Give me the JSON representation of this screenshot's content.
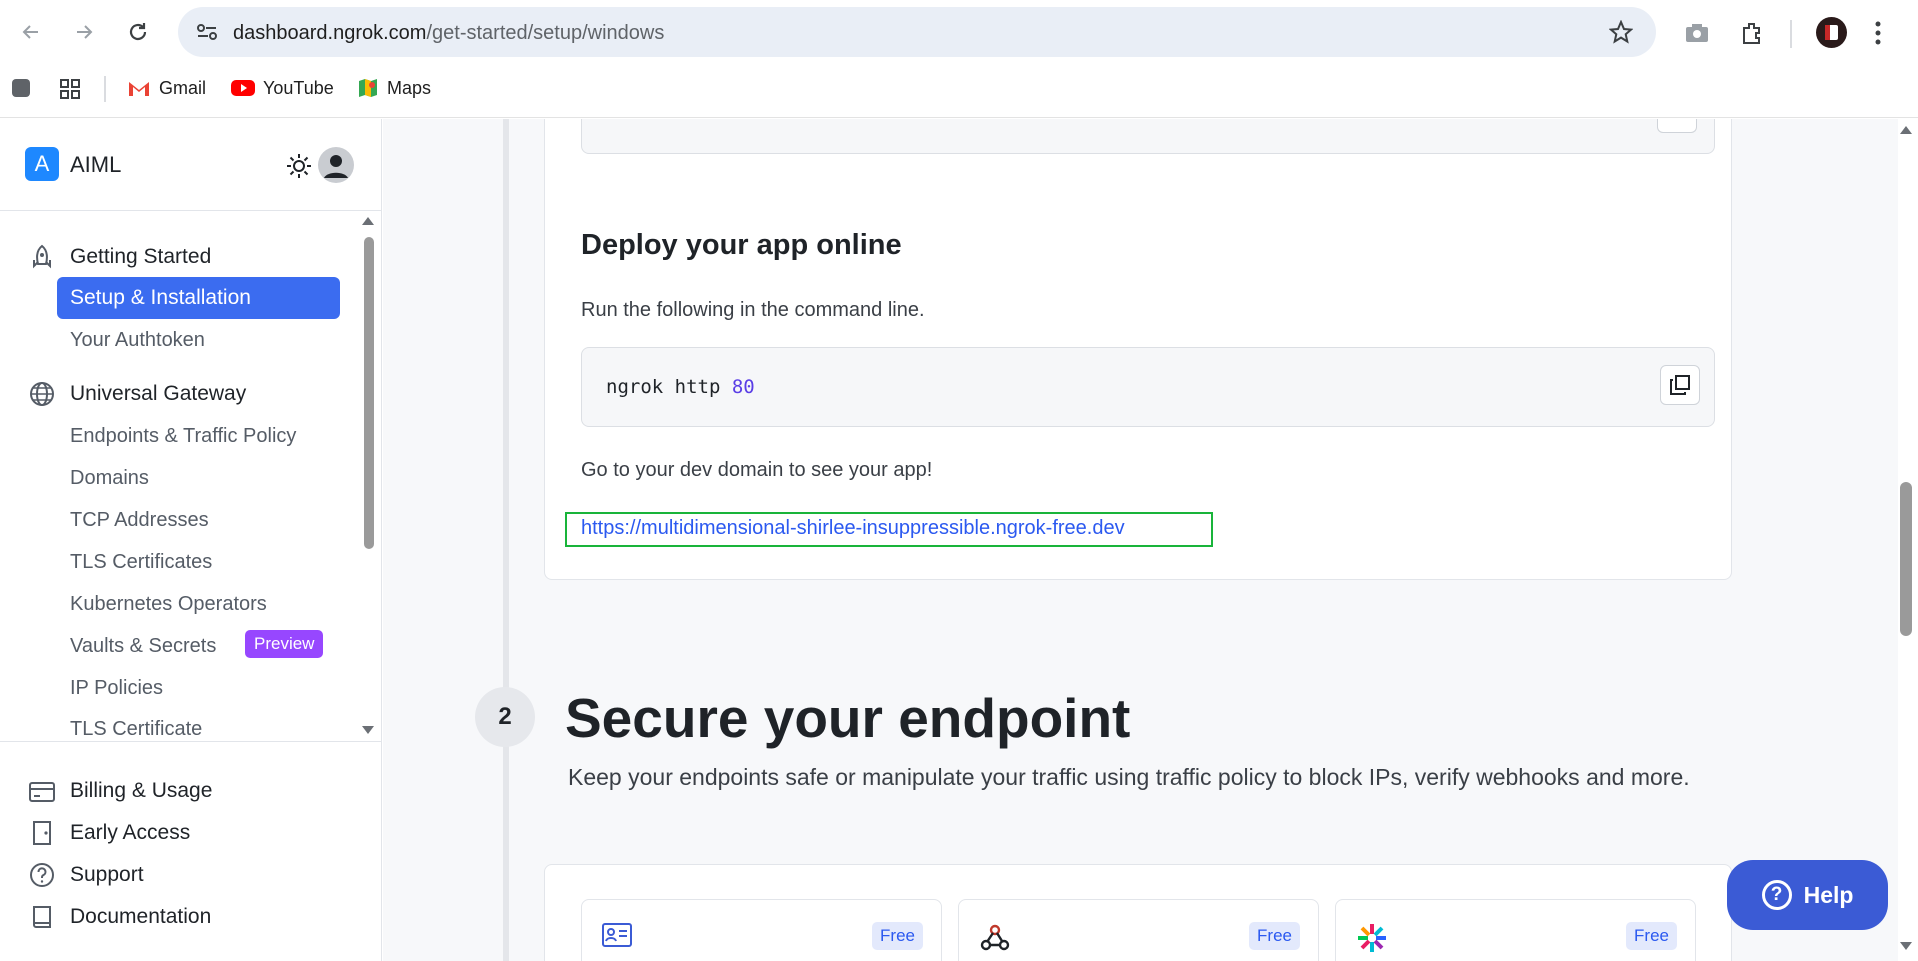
{
  "browser": {
    "url_host": "dashboard.ngrok.com",
    "url_path": "/get-started/setup/windows",
    "bookmarks": [
      {
        "label": "Gmail"
      },
      {
        "label": "YouTube"
      },
      {
        "label": "Maps"
      }
    ]
  },
  "sidebar": {
    "workspace_initial": "A",
    "workspace_name": "AIML",
    "getting_started": "Getting Started",
    "setup_installation": "Setup & Installation",
    "your_authtoken": "Your Authtoken",
    "universal_gateway": "Universal Gateway",
    "endpoints_traffic": "Endpoints & Traffic Policy",
    "domains": "Domains",
    "tcp_addresses": "TCP Addresses",
    "tls_certificates": "TLS Certificates",
    "kubernetes_operators": "Kubernetes Operators",
    "vaults_secrets": "Vaults & Secrets",
    "preview_badge": "Preview",
    "ip_policies": "IP Policies",
    "tls_certificate": "TLS Certificate",
    "billing_usage": "Billing & Usage",
    "early_access": "Early Access",
    "support": "Support",
    "documentation": "Documentation"
  },
  "main": {
    "deploy_title": "Deploy your app online",
    "deploy_desc": "Run the following in the command line.",
    "command": "ngrok http ",
    "command_port": "80",
    "go_text": "Go to your dev domain to see your app!",
    "dev_link": "https://multidimensional-shirlee-insuppressible.ngrok-free.dev",
    "step_number": "2",
    "secure_title": "Secure your endpoint",
    "secure_desc": "Keep your endpoints safe or manipulate your traffic using traffic policy to block IPs, verify webhooks and more.",
    "features": [
      {
        "icon": "id-card-icon",
        "badge": "Free"
      },
      {
        "icon": "webhook-icon",
        "badge": "Free"
      },
      {
        "icon": "burst-icon",
        "badge": "Free"
      }
    ]
  },
  "help": {
    "label": "Help",
    "glyph": "?"
  },
  "colors": {
    "accent": "#3b6cf0",
    "link": "#2b59f0",
    "preview": "#9747ff",
    "highlight_border": "#19b43a",
    "help": "#3b5bd5"
  }
}
